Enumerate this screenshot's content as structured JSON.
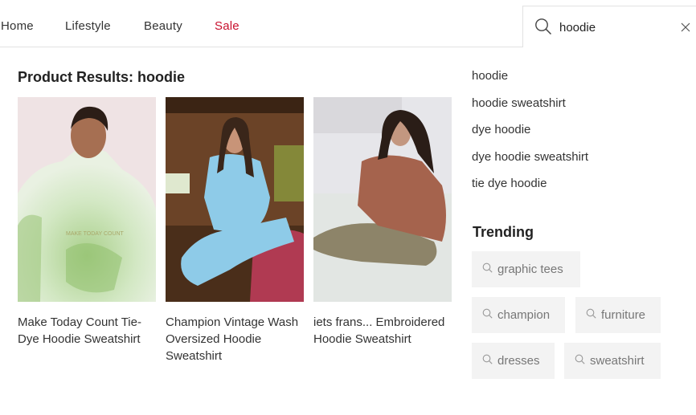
{
  "nav": {
    "items": [
      {
        "label": "Home"
      },
      {
        "label": "Lifestyle"
      },
      {
        "label": "Beauty"
      },
      {
        "label": "Sale",
        "color": "#c8102e"
      }
    ]
  },
  "search": {
    "value": "hoodie",
    "icon": "search-icon",
    "clear_icon": "close-icon"
  },
  "results": {
    "title": "Product Results: hoodie",
    "products": [
      {
        "name": "Make Today Count Tie-Dye Hoodie Sweatshirt",
        "image": "green tie-dye hoodie"
      },
      {
        "name": "Champion Vintage Wash Oversized Hoodie Sweatshirt",
        "image": "light blue hoodie and sweatpants"
      },
      {
        "name": "iets frans... Embroidered Hoodie Sweatshirt",
        "image": "brown hoodie on bed"
      }
    ]
  },
  "suggestions": [
    "hoodie",
    "hoodie sweatshirt",
    "dye hoodie",
    "dye hoodie sweatshirt",
    "tie dye hoodie"
  ],
  "trending": {
    "title": "Trending",
    "chips": [
      "graphic tees",
      "champion",
      "furniture",
      "dresses",
      "sweatshirt"
    ]
  }
}
